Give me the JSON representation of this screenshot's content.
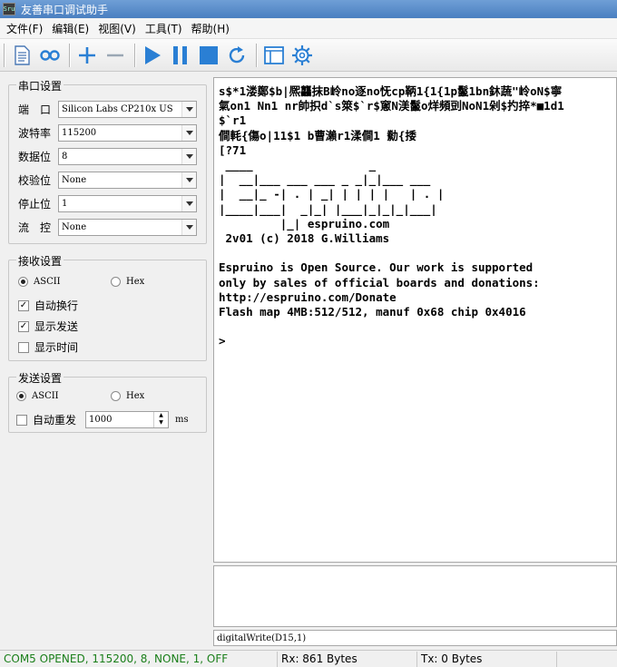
{
  "window": {
    "title": "友善串口调试助手",
    "icon_text": "Sru"
  },
  "menu": [
    "文件(F)",
    "编辑(E)",
    "视图(V)",
    "工具(T)",
    "帮助(H)"
  ],
  "toolbar": {
    "buttons": [
      "new-file-icon",
      "link-icon",
      "add-icon",
      "remove-icon",
      "play-icon",
      "pause-icon",
      "stop-icon",
      "refresh-icon",
      "window-icon",
      "settings-icon"
    ],
    "accent": "#2a7fd4"
  },
  "serial": {
    "title": "串口设置",
    "port_label": "端　口",
    "port_value": "Silicon Labs CP210x US",
    "baud_label": "波特率",
    "baud_value": "115200",
    "data_label": "数据位",
    "data_value": "8",
    "parity_label": "校验位",
    "parity_value": "None",
    "stop_label": "停止位",
    "stop_value": "1",
    "flow_label": "流　控",
    "flow_value": "None"
  },
  "receive": {
    "title": "接收设置",
    "ascii": "ASCII",
    "hex": "Hex",
    "auto_newline": "自动换行",
    "show_send": "显示发送",
    "show_time": "显示时间"
  },
  "send": {
    "title": "发送设置",
    "ascii": "ASCII",
    "hex": "Hex",
    "auto_resend": "自动重发",
    "interval": "1000",
    "unit": "ms",
    "input_value": "digitalWrite(D15,1)"
  },
  "receive_text": "s$*1溇鄭$b|熈龘抹B岭no逐no怃cp鞆1{1{1p鬣1bn鈢蔬\"岭oN$寧\n氣on1 Nn1 nr帥抧d`s箂$`r$窻N渼鬣o烊頻剅NoN1剁$扚捽*■1d1\n$`r1\n僴軞{傷o|11$1 b曹瀨r1渘僴1 勬{捼\n[?71\n ____                 _\n|  __|___ ___ ___ _ _|_|___ ___\n|  __|_ -| . | _| | | | |   | . |\n|____|___|  _|_| |___|_|_|_|___|\n         |_| espruino.com\n 2v01 (c) 2018 G.Williams\n\nEspruino is Open Source. Our work is supported\nonly by sales of official boards and donations:\nhttp://espruino.com/Donate\nFlash map 4MB:512/512, manuf 0x68 chip 0x4016\n\n>",
  "status": {
    "port_state": "COM5 OPENED, 115200, 8, NONE, 1, OFF",
    "rx": "Rx: 861 Bytes",
    "tx": "Tx: 0 Bytes",
    "port_state_color": "#1a7f1a"
  }
}
